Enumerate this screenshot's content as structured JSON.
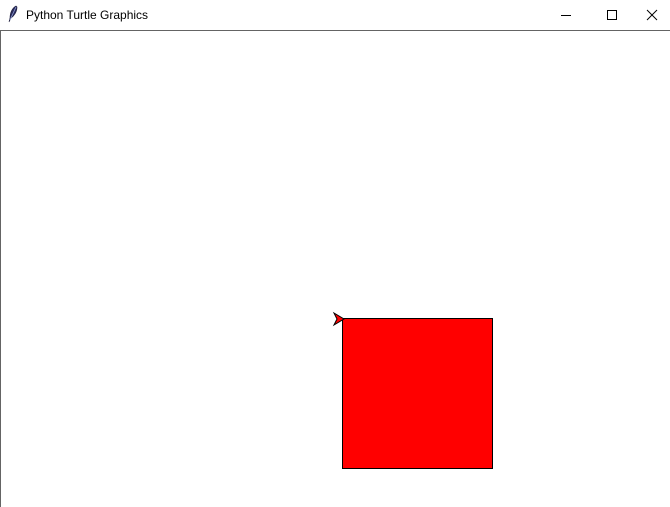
{
  "window": {
    "title": "Python Turtle Graphics",
    "app_icon": "feather-icon",
    "controls": {
      "minimize_icon": "minimize-icon",
      "maximize_icon": "maximize-icon",
      "close_icon": "close-icon"
    }
  },
  "canvas": {
    "background": "#ffffff",
    "square": {
      "fill": "#ff0000",
      "outline": "#000000"
    },
    "turtle": {
      "shape": "arrow",
      "fill": "#ff0000",
      "outline": "#000000",
      "heading": "east"
    }
  }
}
